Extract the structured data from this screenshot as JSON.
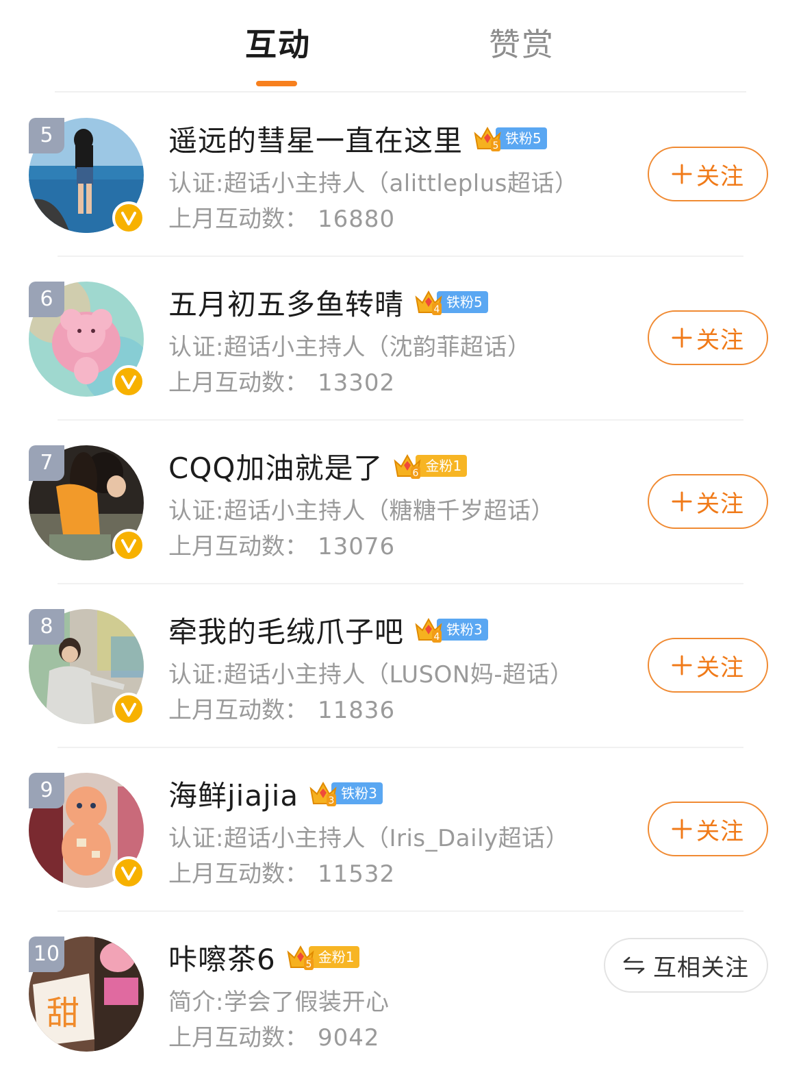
{
  "tabs": {
    "active": "互动",
    "inactive": "赞赏"
  },
  "colors": {
    "accent": "#f7801e",
    "iron_fan": "#5aa7f2",
    "gold_fan": "#f7b524",
    "verified": "#f7b100",
    "rank_badge": "#9aa3b6"
  },
  "count_label": "上月互动数：",
  "follow_label": "关注",
  "mutual_label": "互相关注",
  "users": [
    {
      "rank": "5",
      "name": "遥远的彗星一直在这里",
      "crown_level": "5",
      "fan_badge": "铁粉5",
      "fan_type": "iron",
      "desc": "认证:超话小主持人（alittleplus超话）",
      "count": "16880",
      "button": "follow",
      "avatar_icon": "girl-beach-avatar"
    },
    {
      "rank": "6",
      "name": "五月初五多鱼转晴",
      "crown_level": "4",
      "fan_badge": "铁粉5",
      "fan_type": "iron",
      "desc": "认证:超话小主持人（沈韵菲超话）",
      "count": "13302",
      "button": "follow",
      "avatar_icon": "pink-bear-avatar"
    },
    {
      "rank": "7",
      "name": "CQQ加油就是了",
      "crown_level": "6",
      "fan_badge": "金粉1",
      "fan_type": "gold",
      "desc": "认证:超话小主持人（糖糖千岁超话）",
      "count": "13076",
      "button": "follow",
      "avatar_icon": "girl-orange-top-avatar"
    },
    {
      "rank": "8",
      "name": "牵我的毛绒爪子吧",
      "crown_level": "4",
      "fan_badge": "铁粉3",
      "fan_type": "iron",
      "desc": "认证:超话小主持人（LUSON妈-超话）",
      "count": "11836",
      "button": "follow",
      "avatar_icon": "man-painting-avatar"
    },
    {
      "rank": "9",
      "name": "海鲜jiajia",
      "crown_level": "3",
      "fan_badge": "铁粉3",
      "fan_type": "iron",
      "desc": "认证:超话小主持人（Iris_Daily超话）",
      "count": "11532",
      "button": "follow",
      "avatar_icon": "doll-avatar"
    },
    {
      "rank": "10",
      "name": "咔嚓茶6",
      "crown_level": "5",
      "fan_badge": "金粉1",
      "fan_type": "gold",
      "desc": "简介:学会了假装开心",
      "count": "9042",
      "button": "mutual",
      "avatar_icon": "sweet-sign-avatar"
    }
  ]
}
